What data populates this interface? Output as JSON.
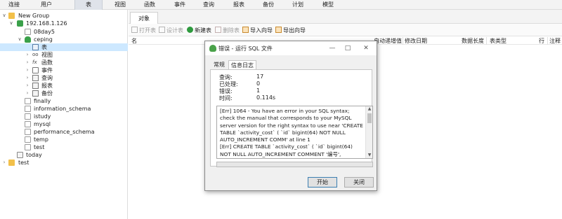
{
  "toolbar": {
    "items": [
      "连接",
      "用户",
      "表",
      "视图",
      "函数",
      "事件",
      "查询",
      "报表",
      "备份",
      "计划",
      "模型"
    ],
    "active_index": 2
  },
  "tree": {
    "group": "New Group",
    "connection": "192.168.1.126",
    "databases_before": [
      "08day5"
    ],
    "open_database": "ceping",
    "nodes": [
      "表",
      "视图",
      "函数",
      "事件",
      "查询",
      "报表",
      "备份"
    ],
    "databases_after": [
      "finally",
      "information_schema",
      "istudy",
      "mysql",
      "performance_schema",
      "temp",
      "test"
    ],
    "connection_sibling": "today",
    "other_group": "test"
  },
  "tabs": {
    "objects": "对象"
  },
  "object_toolbar": {
    "open_table": "打开表",
    "design_table": "设计表",
    "new_table": "新建表",
    "delete_table": "删除表",
    "import_wizard": "导入向导",
    "export_wizard": "导出向导"
  },
  "columns": [
    "名",
    "自动递增值",
    "修改日期",
    "数据长度",
    "表类型",
    "行",
    "注释"
  ],
  "dialog": {
    "title": "错误 - 运行 SQL 文件",
    "tabs": [
      "常规",
      "信息日志"
    ],
    "active_tab": 1,
    "fields": [
      {
        "key": "查询:",
        "value": "17"
      },
      {
        "key": "已处理:",
        "value": "0"
      },
      {
        "key": "错误:",
        "value": "1"
      },
      {
        "key": "时间:",
        "value": "0.114s"
      }
    ],
    "log": "[Err] 1064 - You have an error in your SQL syntax; check the manual that corresponds to your MySQL server version for the right syntax to use near 'CREATE TABLE `activity_cost` (  `id` bigint(64) NOT NULL AUTO_INCREMENT COMM' at line 1\n[Err] CREATE TABLE `activity_cost` (  `id` bigint(64) NOT NULL AUTO_INCREMENT COMMENT '编号',  `activity_id`",
    "progress_fraction": 0,
    "start_button": "开始",
    "close_button": "关闭"
  },
  "colors": {
    "selected_row": "#cde8ff",
    "folder": "#f2c04a",
    "connection": "#3aa04a",
    "new_table_icon": "#2e9a3e"
  }
}
